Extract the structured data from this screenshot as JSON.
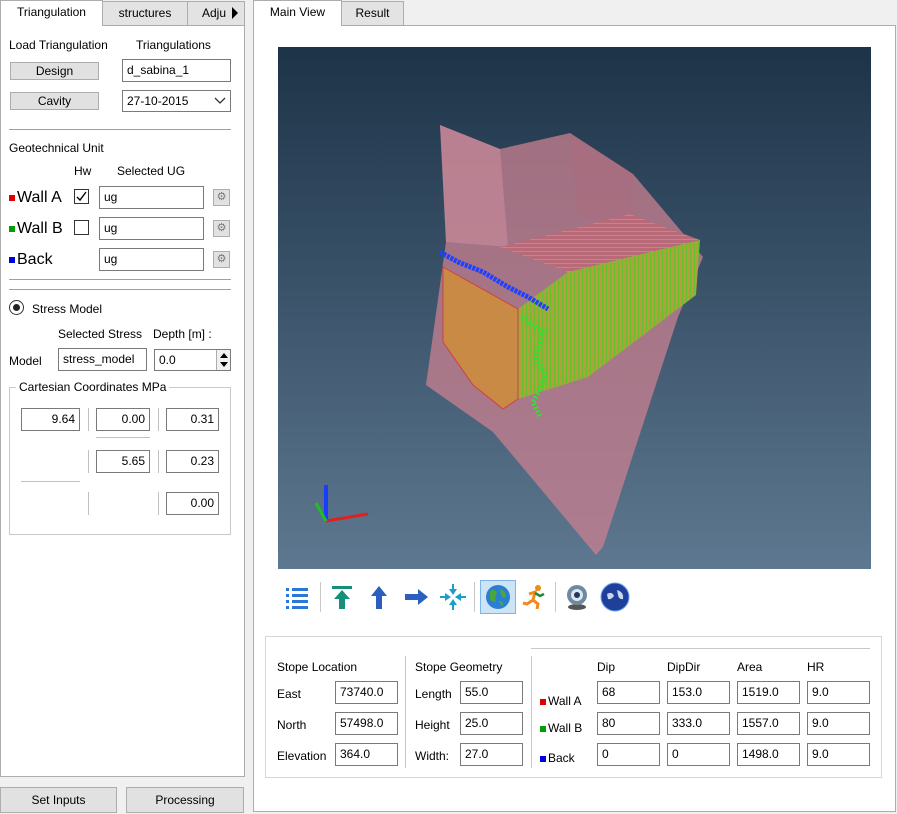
{
  "left_tabs": [
    "Triangulation",
    "structures",
    "Adjust"
  ],
  "right_tabs": [
    "Main View",
    "Result"
  ],
  "load": {
    "load_label": "Load Triangulation",
    "tri_label": "Triangulations",
    "design_btn": "Design",
    "design_value": "d_sabina_1",
    "cavity_btn": "Cavity",
    "cavity_value": "27-10-2015"
  },
  "geo": {
    "title": "Geotechnical Unit",
    "hw_label": "Hw",
    "selected_ug_label": "Selected UG",
    "rows": [
      {
        "name": "Wall A",
        "color": "#e00000",
        "checked": true,
        "value": "ug"
      },
      {
        "name": "Wall B",
        "color": "#00a000",
        "checked": false,
        "value": "ug"
      },
      {
        "name": "Back",
        "color": "#0000e0",
        "value": "ug"
      }
    ]
  },
  "stress": {
    "title": "Stress Model",
    "selected_label": "Selected Stress",
    "depth_label": "Depth [m] :",
    "model_label": "Model",
    "model_value": "stress_model",
    "depth_value": "0.0",
    "cart_title": "Cartesian Coordinates MPa",
    "matrix": [
      [
        "9.64",
        "0.00",
        "0.31"
      ],
      [
        "",
        "5.65",
        "0.23"
      ],
      [
        "",
        "",
        "0.00"
      ]
    ]
  },
  "bottom_buttons": {
    "set_inputs": "Set Inputs",
    "processing": "Processing"
  },
  "toolbar_icons": [
    "list-icon",
    "arrow-up-bar-icon",
    "arrow-up-icon",
    "arrow-right-icon",
    "compress-icon",
    "globe-icon",
    "runner-icon",
    "webcam-icon",
    "earth-sphere-icon"
  ],
  "location": {
    "title": "Stope Location",
    "east_label": "East",
    "east": "73740.0",
    "north_label": "North",
    "north": "57498.0",
    "elev_label": "Elevation",
    "elev": "364.0"
  },
  "geometry": {
    "title": "Stope Geometry",
    "length_label": "Length",
    "length": "55.0",
    "height_label": "Height",
    "height": "25.0",
    "width_label": "Width:",
    "width": "27.0"
  },
  "walls_table": {
    "headers": [
      "Dip",
      "DipDir",
      "Area",
      "HR"
    ],
    "rows": [
      {
        "name": "Wall A",
        "color": "#e00000",
        "values": [
          "68",
          "153.0",
          "1519.0",
          "9.0"
        ]
      },
      {
        "name": "Wall B",
        "color": "#00a000",
        "values": [
          "80",
          "333.0",
          "1557.0",
          "9.0"
        ]
      },
      {
        "name": "Back",
        "color": "#0000e0",
        "values": [
          "0",
          "0",
          "1498.0",
          "9.0"
        ]
      }
    ]
  }
}
